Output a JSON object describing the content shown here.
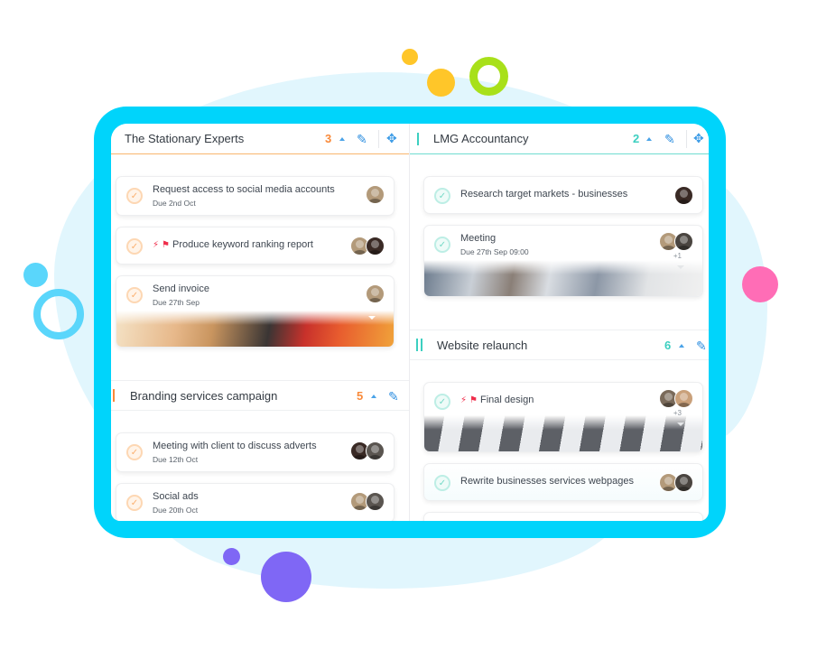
{
  "decor": {
    "blob_color": "#e1f6fd",
    "frame_color": "#00d4fb",
    "dots": [
      {
        "name": "yellow-dot-small",
        "color": "#ffc629"
      },
      {
        "name": "yellow-dot-large",
        "color": "#ffc629"
      },
      {
        "name": "green-ring",
        "color": "#a8e01a"
      },
      {
        "name": "blue-dot",
        "color": "#5ad6fb"
      },
      {
        "name": "blue-ring",
        "color": "#5ad6fb"
      },
      {
        "name": "pink-dot",
        "color": "#ff6db6"
      },
      {
        "name": "purple-dot-small",
        "color": "#7f67f5"
      },
      {
        "name": "purple-dot-large",
        "color": "#7f67f5"
      }
    ]
  },
  "colors": {
    "orange": "#f98a3a",
    "teal": "#3ccfc0",
    "blue": "#2f8fe0",
    "flag_red": "#ef2d4b"
  },
  "groups": [
    {
      "title": "The Stationary Experts",
      "count": "3",
      "accent": "orange",
      "tasks": [
        {
          "title": "Request access to social media accounts",
          "due": "Due 2nd Oct",
          "flags": false,
          "avatars": 1,
          "more": "",
          "image": false
        },
        {
          "title": "Produce keyword ranking report",
          "due": "",
          "flags": true,
          "avatars": 2,
          "more": "",
          "image": false
        },
        {
          "title": "Send invoice",
          "due": "Due 27th Sep",
          "flags": false,
          "avatars": 1,
          "more": "",
          "image": true
        }
      ]
    },
    {
      "title": "Branding services campaign",
      "count": "5",
      "accent": "orange",
      "tasks": [
        {
          "title": "Meeting with client to discuss adverts",
          "due": "Due 12th Oct",
          "flags": false,
          "avatars": 2,
          "more": "",
          "image": false
        },
        {
          "title": "Social ads",
          "due": "Due 20th Oct",
          "flags": false,
          "avatars": 2,
          "more": "",
          "image": false
        }
      ]
    },
    {
      "title": "LMG Accountancy",
      "count": "2",
      "accent": "teal",
      "tasks": [
        {
          "title": "Research target markets - businesses",
          "due": "",
          "flags": false,
          "avatars": 1,
          "more": "",
          "image": false
        },
        {
          "title": "Meeting",
          "due": "Due 27th Sep 09:00",
          "flags": false,
          "avatars": 2,
          "more": "+1",
          "image": true
        }
      ]
    },
    {
      "title": "Website relaunch",
      "count": "6",
      "accent": "teal",
      "tasks": [
        {
          "title": "Final design",
          "due": "",
          "flags": true,
          "avatars": 2,
          "more": "+3",
          "image": true
        },
        {
          "title": "Rewrite businesses services webpages",
          "due": "",
          "flags": false,
          "avatars": 2,
          "more": "",
          "image": false
        }
      ]
    }
  ],
  "icons": {
    "check": "✓",
    "edit": "✎",
    "move": "✥",
    "lightning": "⚡",
    "flag": "⚑"
  }
}
